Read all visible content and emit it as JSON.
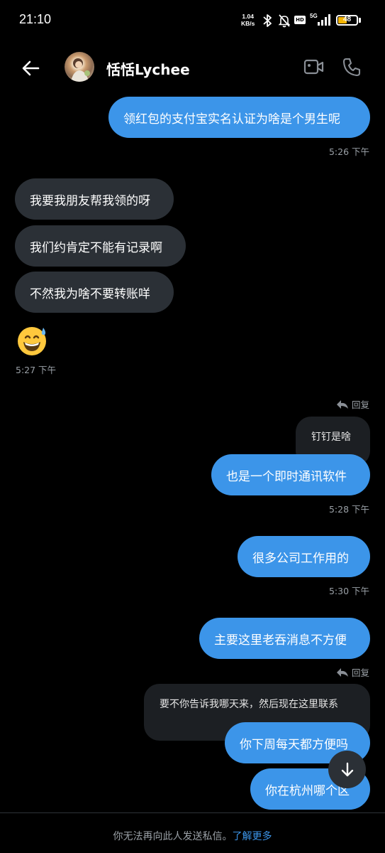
{
  "status_bar": {
    "time": "21:10",
    "speed_value": "1.04",
    "speed_unit": "KB/s",
    "hd_label": "HD",
    "network_label": "5G",
    "battery": "48"
  },
  "header": {
    "name": "恬恬Lychee"
  },
  "messages": {
    "m1": "领红包的支付宝实名认证为啥是个男生呢",
    "t1": "5:26 下午",
    "m2": "我要我朋友帮我领的呀",
    "m3": "我们约肯定不能有记录啊",
    "m4": "不然我为啥不要转账咩",
    "t2": "5:27 下午",
    "reply1_label": "回复",
    "reply1_quote": "钉钉是啥",
    "m5": "也是一个即时通讯软件",
    "t3": "5:28 下午",
    "m6": "很多公司工作用的",
    "t4": "5:30 下午",
    "m7": "主要这里老吞消息不方便",
    "reply2_label": "回复",
    "reply2_quote": "要不你告诉我哪天来，然后现在这里联系",
    "m8": "你下周每天都方便吗",
    "m9": "你在杭州哪个区"
  },
  "footer": {
    "text": "你无法再向此人发送私信。",
    "link": "了解更多"
  },
  "colors": {
    "sent_bubble": "#3c95e9",
    "received_bubble": "#2b3036",
    "background": "#000000",
    "link": "#3c95e9"
  },
  "icons": [
    "back-arrow-icon",
    "video-call-icon",
    "phone-icon",
    "reply-icon",
    "scroll-down-icon",
    "bluetooth-icon",
    "mute-icon",
    "signal-icon",
    "battery-icon"
  ]
}
